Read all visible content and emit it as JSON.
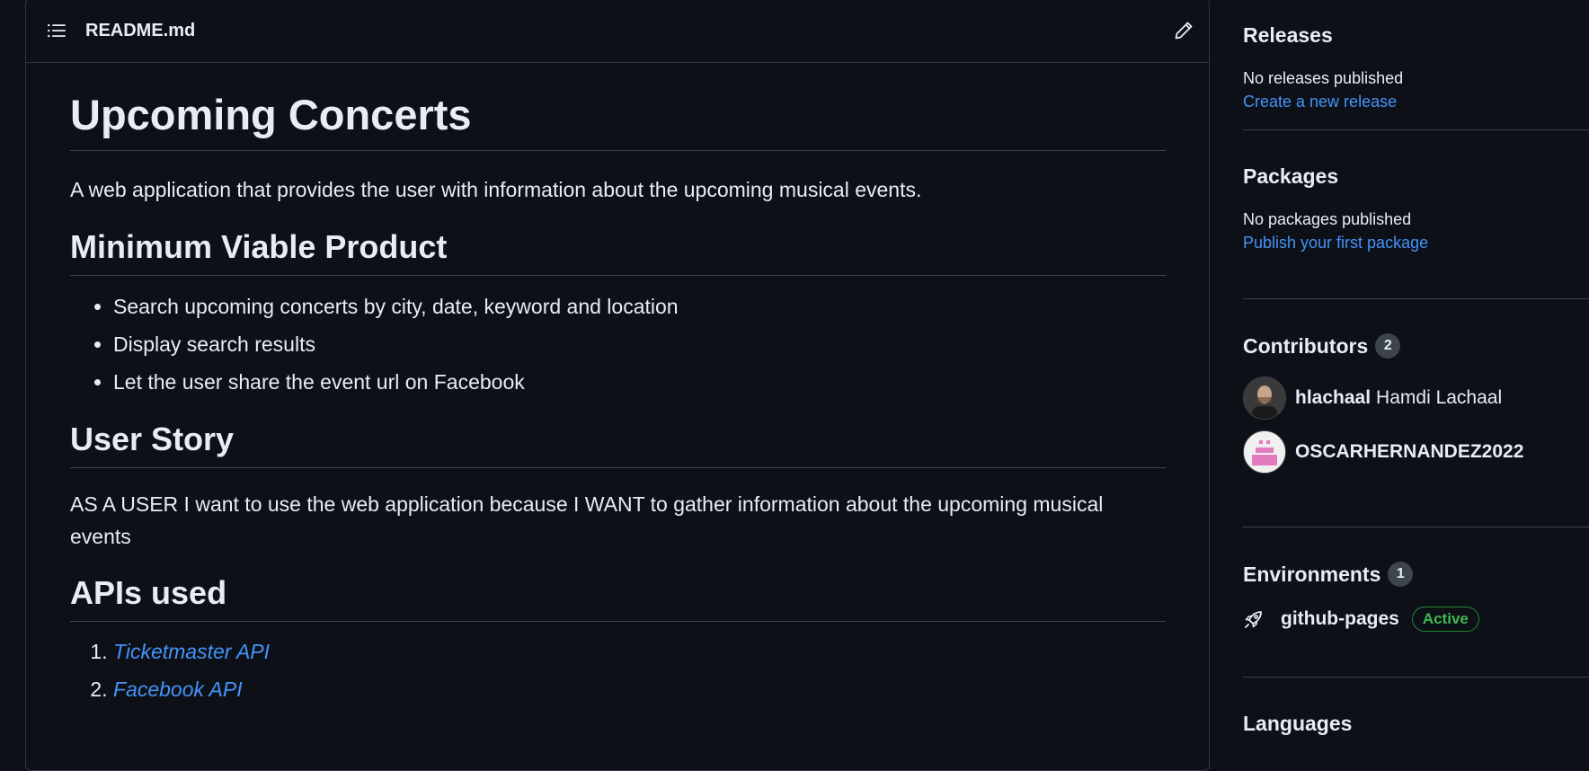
{
  "readme": {
    "filename": "README.md",
    "title": "Upcoming Concerts",
    "description": "A web application that provides the user with information about the upcoming musical events.",
    "mvp": {
      "heading": "Minimum Viable Product",
      "items": [
        "Search upcoming concerts by city, date, keyword and location",
        "Display search results",
        "Let the user share the event url on Facebook"
      ]
    },
    "story": {
      "heading": "User Story",
      "text_line1": "AS A USER I want to use the web application because I WANT to gather information about the upcoming musical",
      "text_line2": "events"
    },
    "apis": {
      "heading": "APIs used",
      "items": [
        "Ticketmaster API",
        "Facebook API"
      ]
    }
  },
  "sidebar": {
    "releases": {
      "title": "Releases",
      "status": "No releases published",
      "link": "Create a new release"
    },
    "packages": {
      "title": "Packages",
      "status": "No packages published",
      "link": "Publish your first package"
    },
    "contributors": {
      "title": "Contributors",
      "count": "2",
      "people": [
        {
          "login": "hlachaal",
          "name": "Hamdi Lachaal"
        },
        {
          "login": "OSCARHERNANDEZ2022",
          "name": ""
        }
      ]
    },
    "environments": {
      "title": "Environments",
      "count": "1",
      "items": [
        {
          "name": "github-pages",
          "status": "Active"
        }
      ]
    },
    "languages": {
      "title": "Languages"
    }
  },
  "colors": {
    "background": "#0d1117",
    "text": "#e6edf3",
    "link": "#4493f8",
    "success": "#3fb950",
    "border": "#30363d"
  },
  "icons": {
    "toc": "list-unordered-icon",
    "edit": "pencil-icon",
    "environment": "rocket-icon"
  }
}
